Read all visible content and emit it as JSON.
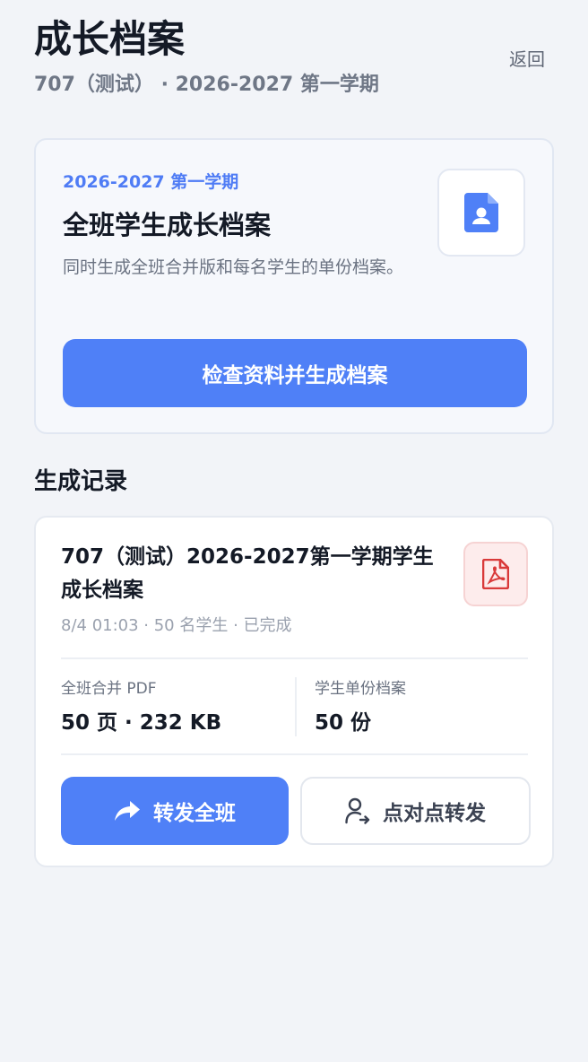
{
  "header": {
    "title": "成长档案",
    "subtitle": "707（测试） · 2026-2027 第一学期",
    "back_label": "返回"
  },
  "hero": {
    "term": "2026-2027 第一学期",
    "title": "全班学生成长档案",
    "description": "同时生成全班合并版和每名学生的单份档案。",
    "icon": "document-user-icon",
    "button_label": "检查资料并生成档案"
  },
  "records": {
    "section_title": "生成记录",
    "items": [
      {
        "title": "707（测试）2026-2027第一学期学生成长档案",
        "meta": "8/4 01:03 · 50 名学生 · 已完成",
        "icon": "pdf-icon",
        "stats": [
          {
            "label": "全班合并 PDF",
            "value": "50 页 · 232 KB"
          },
          {
            "label": "学生单份档案",
            "value": "50 份"
          }
        ],
        "actions": {
          "forward_label": "转发全班",
          "p2p_label": "点对点转发"
        }
      }
    ]
  },
  "colors": {
    "accent": "#4f80f7",
    "background": "#f2f4f8",
    "pdf_red": "#d93a3a"
  }
}
